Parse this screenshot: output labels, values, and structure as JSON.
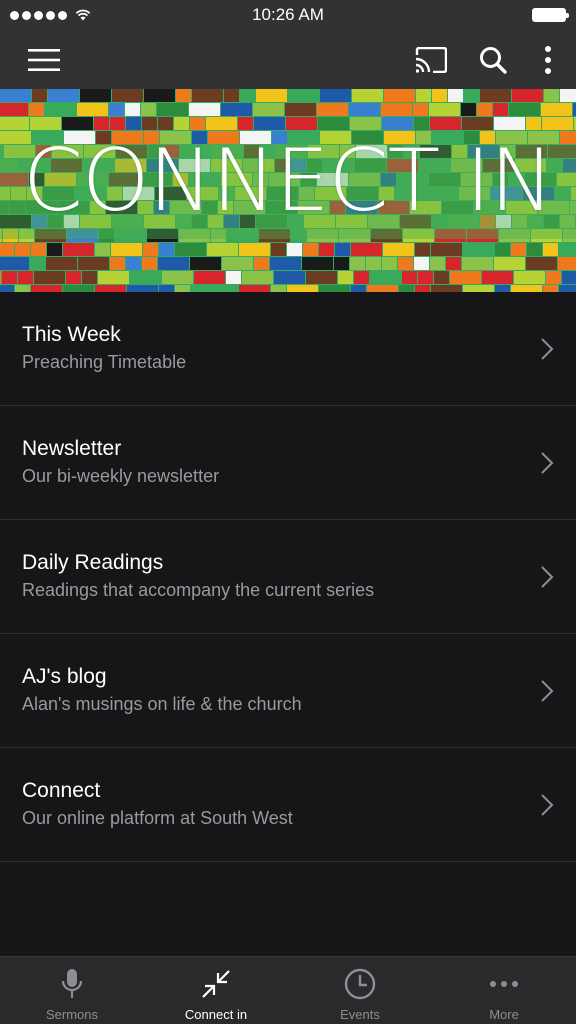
{
  "status_bar": {
    "time": "10:26 AM"
  },
  "banner": {
    "title": "CONNECT IN"
  },
  "list": [
    {
      "title": "This Week",
      "subtitle": "Preaching Timetable"
    },
    {
      "title": "Newsletter",
      "subtitle": "Our bi-weekly newsletter"
    },
    {
      "title": "Daily Readings",
      "subtitle": "Readings that accompany the current series"
    },
    {
      "title": "AJ's blog",
      "subtitle": "Alan's musings on life & the church"
    },
    {
      "title": "Connect",
      "subtitle": "Our online platform at South West"
    }
  ],
  "tabs": [
    {
      "label": "Sermons",
      "icon": "microphone-icon",
      "active": false
    },
    {
      "label": "Connect in",
      "icon": "arrows-in-icon",
      "active": true
    },
    {
      "label": "Events",
      "icon": "clock-icon",
      "active": false
    },
    {
      "label": "More",
      "icon": "ellipsis-icon",
      "active": false
    }
  ],
  "colors": {
    "bar": "#323234",
    "background": "#161618",
    "tab_bar": "#2a2a2c",
    "subtitle": "#9a9a9e"
  }
}
